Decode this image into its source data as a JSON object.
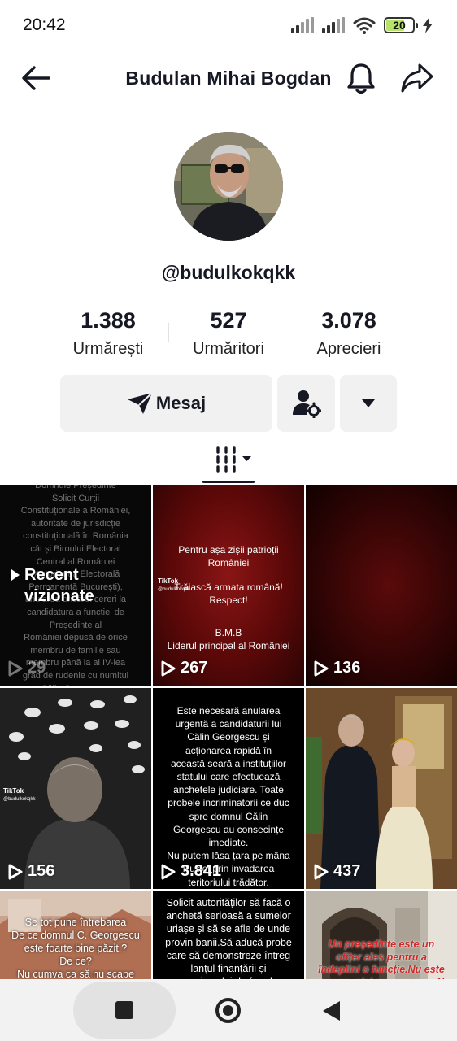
{
  "status_bar": {
    "time": "20:42",
    "battery_level": "20",
    "icons": [
      "signal-icon",
      "signal-icon",
      "wifi-icon",
      "battery-icon",
      "charging-icon"
    ]
  },
  "header": {
    "title": "Budulan Mihai Bogdan",
    "icons": [
      "back-arrow-icon",
      "bell-icon",
      "share-icon"
    ]
  },
  "profile": {
    "username": "@budulkokqkk",
    "stats": [
      {
        "value": "1.388",
        "label": "Urmărești"
      },
      {
        "value": "527",
        "label": "Urmăritori"
      },
      {
        "value": "3.078",
        "label": "Aprecieri"
      }
    ]
  },
  "actions": {
    "message_label": "Mesaj",
    "icons": [
      "send-icon",
      "user-settings-icon",
      "caret-down-icon"
    ]
  },
  "tabs": {
    "active_icon": "grid-lines-icon"
  },
  "videos": [
    {
      "views": "29",
      "overlay": "Recent\nvizionate",
      "text": "Domnule Președinte\nSolicit Curții\nConstituționale a României,\nautoritate de jurisdicție\nconstituțională în România\ncât și Biroului Electoral\nCentral al României\n(Autoritatea Electorală\nPermanentă București),\nanularea oricărei cereri la\ncandidatura a funcției de\nPreședinte al\nRomâniei depusă de orice\nmembru de familie sau\nmembru până la al IV-lea\ngrad de rudenie cu numitul\nCălin Georgescu.\nDomnule Președinte al\nCurții Constituționale a\nRomâniei"
    },
    {
      "views": "267",
      "text_top": "Pentru așa zișii patrioții\nRomâniei",
      "text_mid": "Trăiască armata română!\nRespect!",
      "text_bottom": "B.M.B\nLiderul principal al României",
      "mark": "TikTok",
      "handle": "@budulkokqkk"
    },
    {
      "views": "136"
    },
    {
      "views": "156",
      "mark": "TikTok",
      "handle": "@budulkokqkk"
    },
    {
      "views": "3.841",
      "text": "Este necesară anularea\nurgentă a candidaturii lui\nCălin Georgescu și\nacționarea rapidă în\naceastă seară a instituțiilor\nstatului care efectuează\nanchetele judiciare. Toate\nprobele incriminatorii ce duc\nspre domnul Călin\nGeorgescu au consecințe\nimediate.\nNu putem lăsa țara pe mâna\nRusiei prin invadarea\nteritoriului trădător.\nB.M.B"
    },
    {
      "views": "437"
    },
    {
      "text": "Se tot pune întrebarea\nDe ce domnul C. Georgescu\neste foarte bine păzit.?\nDe ce?\nNu cumva ca să nu scape"
    },
    {
      "text": "Solicit autorităților să facă o\nanchetă serioasă a sumelor\nuriașe și să se afle de unde\nprovin banii.Să aducă probe\ncare să demonstreze întreg\nlanțul finanțării și\nmecanismului de fraudare"
    },
    {
      "text": "Un președinte este un\nofițer ales pentru a\nîndeplini o funcție.Nu este\nun rege, nici nu e un zeu. Nu"
    }
  ],
  "navbar": {
    "icons": [
      "recents-square-icon",
      "home-circle-icon",
      "back-triangle-icon"
    ]
  },
  "colors": {
    "text": "#161823",
    "button_bg": "#f1f1f2",
    "battery": "#b7e36b"
  }
}
